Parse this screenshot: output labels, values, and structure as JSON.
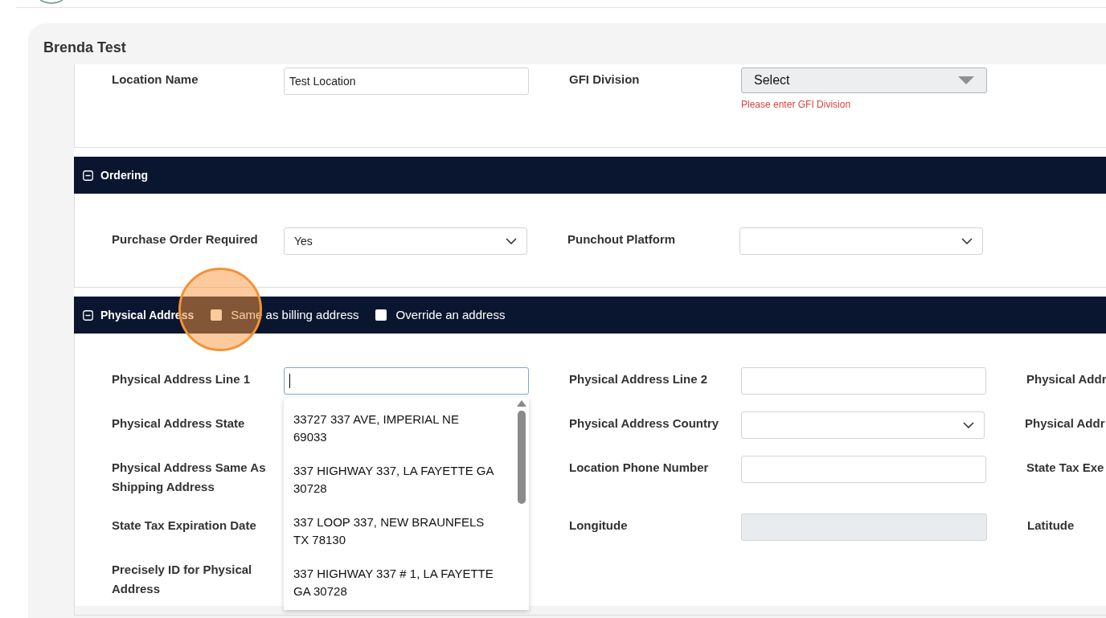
{
  "card": {
    "title": "Brenda Test"
  },
  "sections": [
    {
      "rows": [
        [
          {
            "label": "Location Name",
            "kind": "text",
            "value": "Test Location"
          },
          {
            "label": "GFI Division",
            "kind": "dropdown",
            "value": "Select",
            "error": "Please enter GFI Division"
          }
        ]
      ]
    },
    {
      "title": "Ordering",
      "expanded": true,
      "rows": [
        [
          {
            "label": "Purchase Order Required",
            "kind": "select",
            "value": "Yes"
          },
          {
            "label": "Punchout Platform",
            "kind": "select"
          }
        ]
      ]
    },
    {
      "title": "Physical Address",
      "expanded": true,
      "checkboxes": [
        {
          "label": "Same as billing address",
          "checked": false
        },
        {
          "label": "Override an address",
          "checked": false
        }
      ],
      "rows": [
        [
          {
            "label": "Physical Address Line 1",
            "kind": "text",
            "focused": true,
            "suggestions": [
              "33727 337 AVE, IMPERIAL NE 69033",
              "337 HIGHWAY 337, LA FAYETTE GA 30728",
              "337 LOOP 337, NEW BRAUNFELS TX 78130",
              "337 HIGHWAY 337 # 1, LA FAYETTE GA 30728"
            ]
          },
          {
            "label": "Physical Address Line 2",
            "kind": "text"
          },
          {
            "label": "Physical Addr",
            "kind": "none"
          }
        ],
        [
          {
            "label": "Physical Address State",
            "kind": "none"
          },
          {
            "label": "Physical Address Country",
            "kind": "select"
          },
          {
            "label": "Physical Addr",
            "kind": "none"
          }
        ],
        [
          {
            "label": "Physical Address Same As Shipping Address",
            "kind": "none"
          },
          {
            "label": "Location Phone Number",
            "kind": "text"
          },
          {
            "label": "State Tax Exe",
            "kind": "none"
          }
        ],
        [
          {
            "label": "State Tax Expiration Date",
            "kind": "none"
          },
          {
            "label": "Longitude",
            "kind": "readonly"
          },
          {
            "label": "Latitude",
            "kind": "none"
          }
        ],
        [
          {
            "label": "Precisely ID for Physical Address",
            "kind": "none"
          }
        ]
      ]
    }
  ]
}
